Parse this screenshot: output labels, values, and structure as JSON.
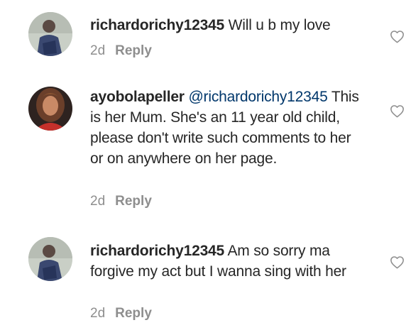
{
  "comments": [
    {
      "username": "richardorichy12345",
      "mention": "",
      "text": " Will u b my love",
      "time": "2d",
      "reply_label": "Reply"
    },
    {
      "username": "ayobolapeller",
      "mention": "@richardorichy12345",
      "text": "This is her Mum. She's an 11 year old child, please don't write such comments to her or on anywhere on her page.",
      "time": "2d",
      "reply_label": "Reply"
    },
    {
      "username": "richardorichy12345",
      "mention": "",
      "text": " Am so sorry ma forgive my act but I wanna sing with her",
      "time": "2d",
      "reply_label": "Reply"
    }
  ],
  "icons": {
    "like": "heart-outline-icon"
  },
  "colors": {
    "text": "#262626",
    "secondary": "#8e8e8e",
    "mention": "#00376b"
  }
}
